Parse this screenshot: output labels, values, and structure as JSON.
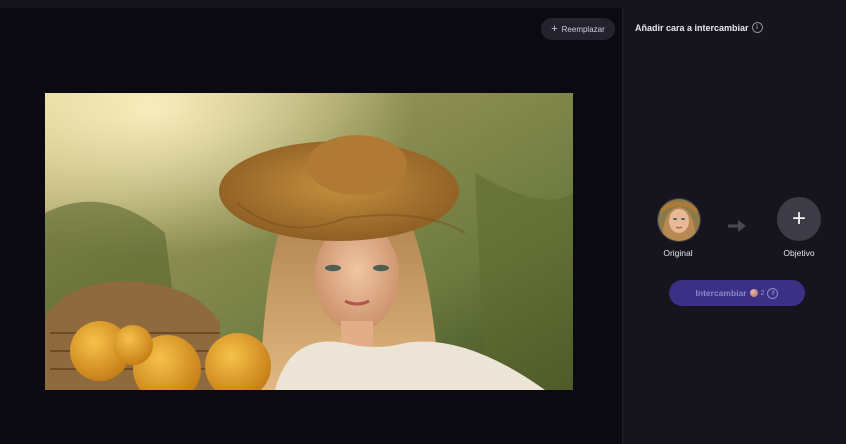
{
  "toolbar": {
    "replace_label": "Reemplazar"
  },
  "panel": {
    "title": "Añadir cara a intercambiar",
    "original_label": "Original",
    "target_label": "Objetivo",
    "swap_button": {
      "label": "Intercambiar",
      "credit_count": "2"
    }
  },
  "icons": {
    "replace": "plus-icon",
    "title_info": "info-icon",
    "arrow": "arrow-right-icon",
    "target": "plus-icon",
    "credits": "credit-coin-icon",
    "swap_info": "help-icon"
  },
  "colors": {
    "background": "#0c0a14",
    "panel": "#16141d",
    "swap_button": "#3b2f86",
    "target_button": "#3d3b45"
  }
}
